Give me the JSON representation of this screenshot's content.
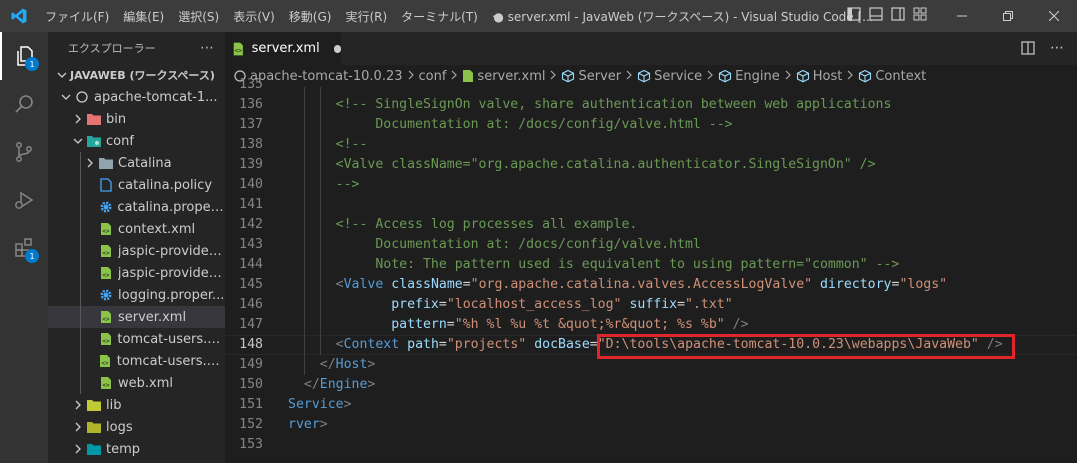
{
  "titlebar": {
    "menu": [
      "ファイル(F)",
      "編集(E)",
      "選択(S)",
      "表示(V)",
      "移動(G)",
      "実行(R)",
      "ターミナル(T)",
      "⋯"
    ],
    "title": "● server.xml - JavaWeb (ワークスペース) - Visual Studio Code [..."
  },
  "activity": {
    "explorer_badge": "1",
    "extensions_badge": "1"
  },
  "sidebar": {
    "header": "エクスプローラー",
    "header_more": "⋯",
    "workspace": "JAVAWEB (ワークスペース)",
    "items": [
      {
        "label": "apache-tomcat-1...",
        "level": 1,
        "icon": "circle-outline-icon",
        "expanded": true
      },
      {
        "label": "bin",
        "level": 2,
        "icon": "folder-red-icon",
        "expanded": false
      },
      {
        "label": "conf",
        "level": 2,
        "icon": "folder-config-icon",
        "expanded": true
      },
      {
        "label": "Catalina",
        "level": 3,
        "icon": "folder-icon",
        "expanded": false
      },
      {
        "label": "catalina.policy",
        "level": 3,
        "icon": "file-icon"
      },
      {
        "label": "catalina.proper...",
        "level": 3,
        "icon": "gear-icon"
      },
      {
        "label": "context.xml",
        "level": 3,
        "icon": "xml-icon"
      },
      {
        "label": "jaspic-provider...",
        "level": 3,
        "icon": "xml-icon"
      },
      {
        "label": "jaspic-provider...",
        "level": 3,
        "icon": "xml-icon"
      },
      {
        "label": "logging.proper...",
        "level": 3,
        "icon": "gear-icon"
      },
      {
        "label": "server.xml",
        "level": 3,
        "icon": "xml-icon",
        "selected": true
      },
      {
        "label": "tomcat-users.x...",
        "level": 3,
        "icon": "xml-icon"
      },
      {
        "label": "tomcat-users.xsd",
        "level": 3,
        "icon": "xml-icon"
      },
      {
        "label": "web.xml",
        "level": 3,
        "icon": "xml-icon"
      },
      {
        "label": "lib",
        "level": 2,
        "icon": "folder-lib-icon",
        "expanded": false
      },
      {
        "label": "logs",
        "level": 2,
        "icon": "folder-logs-icon",
        "expanded": false
      },
      {
        "label": "temp",
        "level": 2,
        "icon": "folder-temp-icon",
        "expanded": false
      }
    ]
  },
  "tab": {
    "label": "server.xml"
  },
  "breadcrumb": [
    "apache-tomcat-10.0.23",
    "conf",
    "server.xml",
    "Server",
    "Service",
    "Engine",
    "Host",
    "Context"
  ],
  "editor": {
    "current_line": "148",
    "lines": [
      {
        "n": "135",
        "tokens": []
      },
      {
        "n": "136",
        "tokens": [
          {
            "t": "cm",
            "v": "      <!-- SingleSignOn valve, share authentication between web applications"
          }
        ]
      },
      {
        "n": "137",
        "tokens": [
          {
            "t": "cm",
            "v": "           Documentation at: /docs/config/valve.html -->"
          }
        ]
      },
      {
        "n": "138",
        "tokens": [
          {
            "t": "cm",
            "v": "      <!--"
          }
        ]
      },
      {
        "n": "139",
        "tokens": [
          {
            "t": "cm",
            "v": "      <Valve className=\"org.apache.catalina.authenticator.SingleSignOn\" />"
          }
        ]
      },
      {
        "n": "140",
        "tokens": [
          {
            "t": "cm",
            "v": "      -->"
          }
        ]
      },
      {
        "n": "141",
        "tokens": []
      },
      {
        "n": "142",
        "tokens": [
          {
            "t": "cm",
            "v": "      <!-- Access log processes all example."
          }
        ]
      },
      {
        "n": "143",
        "tokens": [
          {
            "t": "cm",
            "v": "           Documentation at: /docs/config/valve.html"
          }
        ]
      },
      {
        "n": "144",
        "tokens": [
          {
            "t": "cm",
            "v": "           Note: The pattern used is equivalent to using pattern=\"common\" -->"
          }
        ]
      },
      {
        "n": "145",
        "tokens": [
          {
            "t": "tx",
            "v": "      "
          },
          {
            "t": "br",
            "v": "<"
          },
          {
            "t": "tg",
            "v": "Valve"
          },
          {
            "t": "tx",
            "v": " "
          },
          {
            "t": "at",
            "v": "className"
          },
          {
            "t": "tx",
            "v": "="
          },
          {
            "t": "st",
            "v": "\"org.apache.catalina.valves.AccessLogValve\""
          },
          {
            "t": "tx",
            "v": " "
          },
          {
            "t": "at",
            "v": "directory"
          },
          {
            "t": "tx",
            "v": "="
          },
          {
            "t": "st",
            "v": "\"logs\""
          }
        ]
      },
      {
        "n": "146",
        "tokens": [
          {
            "t": "tx",
            "v": "             "
          },
          {
            "t": "at",
            "v": "prefix"
          },
          {
            "t": "tx",
            "v": "="
          },
          {
            "t": "st",
            "v": "\"localhost_access_log\""
          },
          {
            "t": "tx",
            "v": " "
          },
          {
            "t": "at",
            "v": "suffix"
          },
          {
            "t": "tx",
            "v": "="
          },
          {
            "t": "st",
            "v": "\".txt\""
          }
        ]
      },
      {
        "n": "147",
        "tokens": [
          {
            "t": "tx",
            "v": "             "
          },
          {
            "t": "at",
            "v": "pattern"
          },
          {
            "t": "tx",
            "v": "="
          },
          {
            "t": "st",
            "v": "\"%h %l %u %t &quot;%r&quot; %s %b\""
          },
          {
            "t": "tx",
            "v": " "
          },
          {
            "t": "br",
            "v": "/>"
          }
        ]
      },
      {
        "n": "148",
        "tokens": [
          {
            "t": "tx",
            "v": "      "
          },
          {
            "t": "br",
            "v": "<"
          },
          {
            "t": "tg",
            "v": "Context"
          },
          {
            "t": "tx",
            "v": " "
          },
          {
            "t": "at",
            "v": "path"
          },
          {
            "t": "tx",
            "v": "="
          },
          {
            "t": "st",
            "v": "\"projects\""
          },
          {
            "t": "tx",
            "v": " "
          },
          {
            "t": "at",
            "v": "docBase"
          },
          {
            "t": "tx",
            "v": "="
          },
          {
            "t": "st",
            "v": "\"D:\\tools\\apache-tomcat-10.0.23\\webapps\\JavaWeb\""
          },
          {
            "t": "tx",
            "v": " "
          },
          {
            "t": "br",
            "v": "/>"
          }
        ]
      },
      {
        "n": "149",
        "tokens": [
          {
            "t": "tx",
            "v": "    "
          },
          {
            "t": "br",
            "v": "</"
          },
          {
            "t": "tg",
            "v": "Host"
          },
          {
            "t": "br",
            "v": ">"
          }
        ]
      },
      {
        "n": "150",
        "tokens": [
          {
            "t": "br",
            "v": "  </"
          },
          {
            "t": "tg",
            "v": "Engine"
          },
          {
            "t": "br",
            "v": ">"
          }
        ]
      },
      {
        "n": "151",
        "tokens": [
          {
            "t": "tg",
            "v": "Service"
          },
          {
            "t": "br",
            "v": ">"
          }
        ]
      },
      {
        "n": "152",
        "tokens": [
          {
            "t": "tg",
            "v": "rver"
          },
          {
            "t": "br",
            "v": ">"
          }
        ]
      },
      {
        "n": "153",
        "tokens": []
      }
    ]
  }
}
